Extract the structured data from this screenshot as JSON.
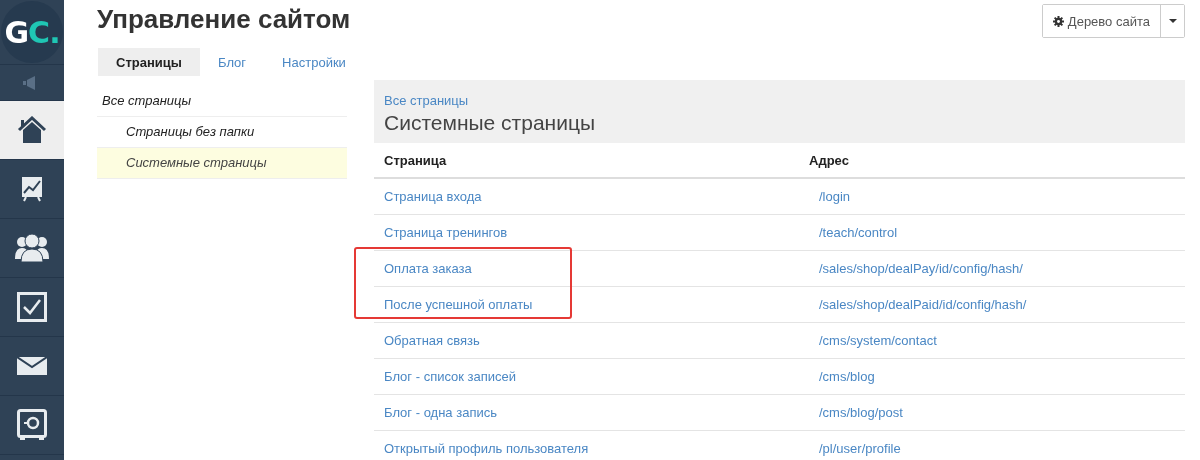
{
  "sidebar": {
    "logo": {
      "letter_1": "G",
      "letter_2": "C",
      "dot": "."
    },
    "items": [
      {
        "kind": "speaker",
        "selected": false
      },
      {
        "kind": "home",
        "selected": true
      },
      {
        "kind": "chart",
        "selected": false
      },
      {
        "kind": "users",
        "selected": false
      },
      {
        "kind": "check",
        "selected": false
      },
      {
        "kind": "mail",
        "selected": false
      },
      {
        "kind": "safe",
        "selected": false
      }
    ]
  },
  "page": {
    "title": "Управление сайтом",
    "tree_button": {
      "label": "Дерево сайта"
    }
  },
  "tabs": [
    {
      "label": "Страницы",
      "selected": true
    },
    {
      "label": "Блог",
      "selected": false
    },
    {
      "label": "Настройки",
      "selected": false
    }
  ],
  "folders": [
    {
      "label": "Все страницы",
      "selected": false,
      "children": [
        {
          "label": "Страницы без папки",
          "selected": false
        },
        {
          "label": "Системные страницы",
          "selected": true
        }
      ]
    }
  ],
  "panel": {
    "breadcrumb": "Все страницы",
    "heading": "Системные страницы"
  },
  "table": {
    "columns": [
      "Страница",
      "Адрес"
    ],
    "rows": [
      {
        "page": "Страница входа",
        "address": "/login",
        "highlighted": false
      },
      {
        "page": "Страница тренингов",
        "address": "/teach/control",
        "highlighted": false
      },
      {
        "page": "Оплата заказа",
        "address": "/sales/shop/dealPay/id/config/hash/",
        "highlighted": true
      },
      {
        "page": "После успешной оплаты",
        "address": "/sales/shop/dealPaid/id/config/hash/",
        "highlighted": true
      },
      {
        "page": "Обратная связь",
        "address": "/cms/system/contact",
        "highlighted": false
      },
      {
        "page": "Блог - список записей",
        "address": "/cms/blog",
        "highlighted": false
      },
      {
        "page": "Блог - одна запись",
        "address": "/cms/blog/post",
        "highlighted": false
      },
      {
        "page": "Открытый профиль пользователя",
        "address": "/pl/user/profile",
        "highlighted": false
      }
    ]
  }
}
